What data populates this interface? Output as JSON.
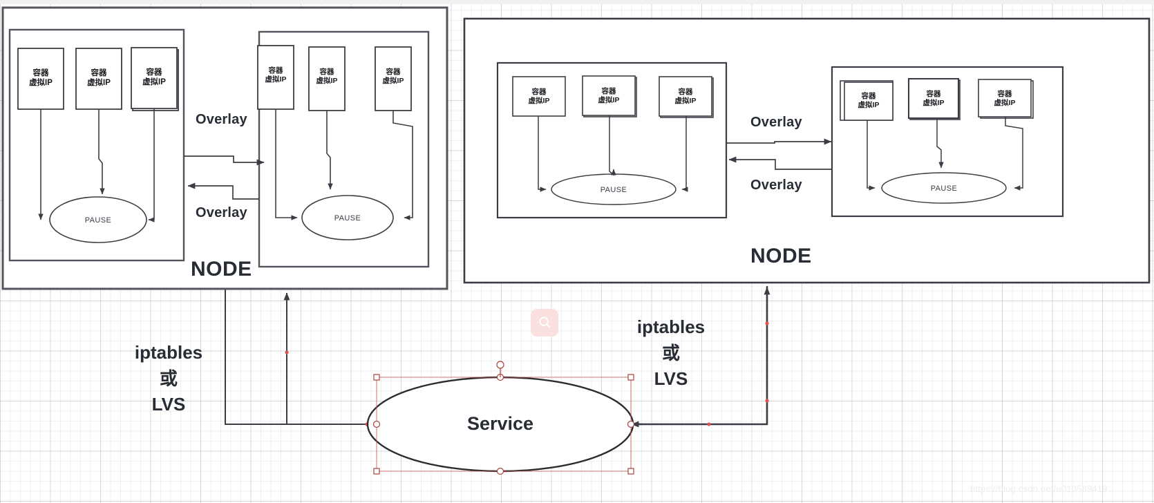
{
  "canvas": {
    "background_color": "#ffffff",
    "grid_color": "#e8e8e8",
    "stroke_color": "#3c3c44",
    "selection_color": "#c0544d"
  },
  "watermark": {
    "url": "https://blog.csdn.net/u010569419",
    "logo_name": "csdn-logo"
  },
  "nodes": [
    {
      "id": "node-left",
      "label": "NODE",
      "pods": [
        {
          "id": "pod-left-a",
          "containers": [
            {
              "line1": "容器",
              "line2": "虚拟IP"
            },
            {
              "line1": "容器",
              "line2": "虚拟IP"
            },
            {
              "line1": "容器",
              "line2": "虚拟IP"
            }
          ],
          "pause_label": "PAUSE"
        },
        {
          "id": "pod-left-b",
          "containers": [
            {
              "line1": "容器",
              "line2": "虚拟IP"
            },
            {
              "line1": "容器",
              "line2": "虚拟IP"
            },
            {
              "line1": "容器",
              "line2": "虚拟IP"
            }
          ],
          "pause_label": "PAUSE"
        }
      ],
      "overlay_labels": [
        "Overlay",
        "Overlay"
      ]
    },
    {
      "id": "node-right",
      "label": "NODE",
      "pods": [
        {
          "id": "pod-right-a",
          "containers": [
            {
              "line1": "容器",
              "line2": "虚拟IP"
            },
            {
              "line1": "容器",
              "line2": "虚拟IP"
            },
            {
              "line1": "容器",
              "line2": "虚拟IP"
            }
          ],
          "pause_label": "PAUSE"
        },
        {
          "id": "pod-right-b",
          "containers": [
            {
              "line1": "容器",
              "line2": "虚拟IP"
            },
            {
              "line1": "容器",
              "line2": "虚拟IP"
            },
            {
              "line1": "容器",
              "line2": "虚拟IP"
            }
          ],
          "pause_label": "PAUSE"
        }
      ],
      "overlay_labels": [
        "Overlay",
        "Overlay"
      ]
    }
  ],
  "service": {
    "label": "Service",
    "selected": true
  },
  "routing": {
    "left": {
      "line1": "iptables",
      "line2": "或",
      "line3": "LVS"
    },
    "right": {
      "line1": "iptables",
      "line2": "或",
      "line3": "LVS"
    }
  }
}
